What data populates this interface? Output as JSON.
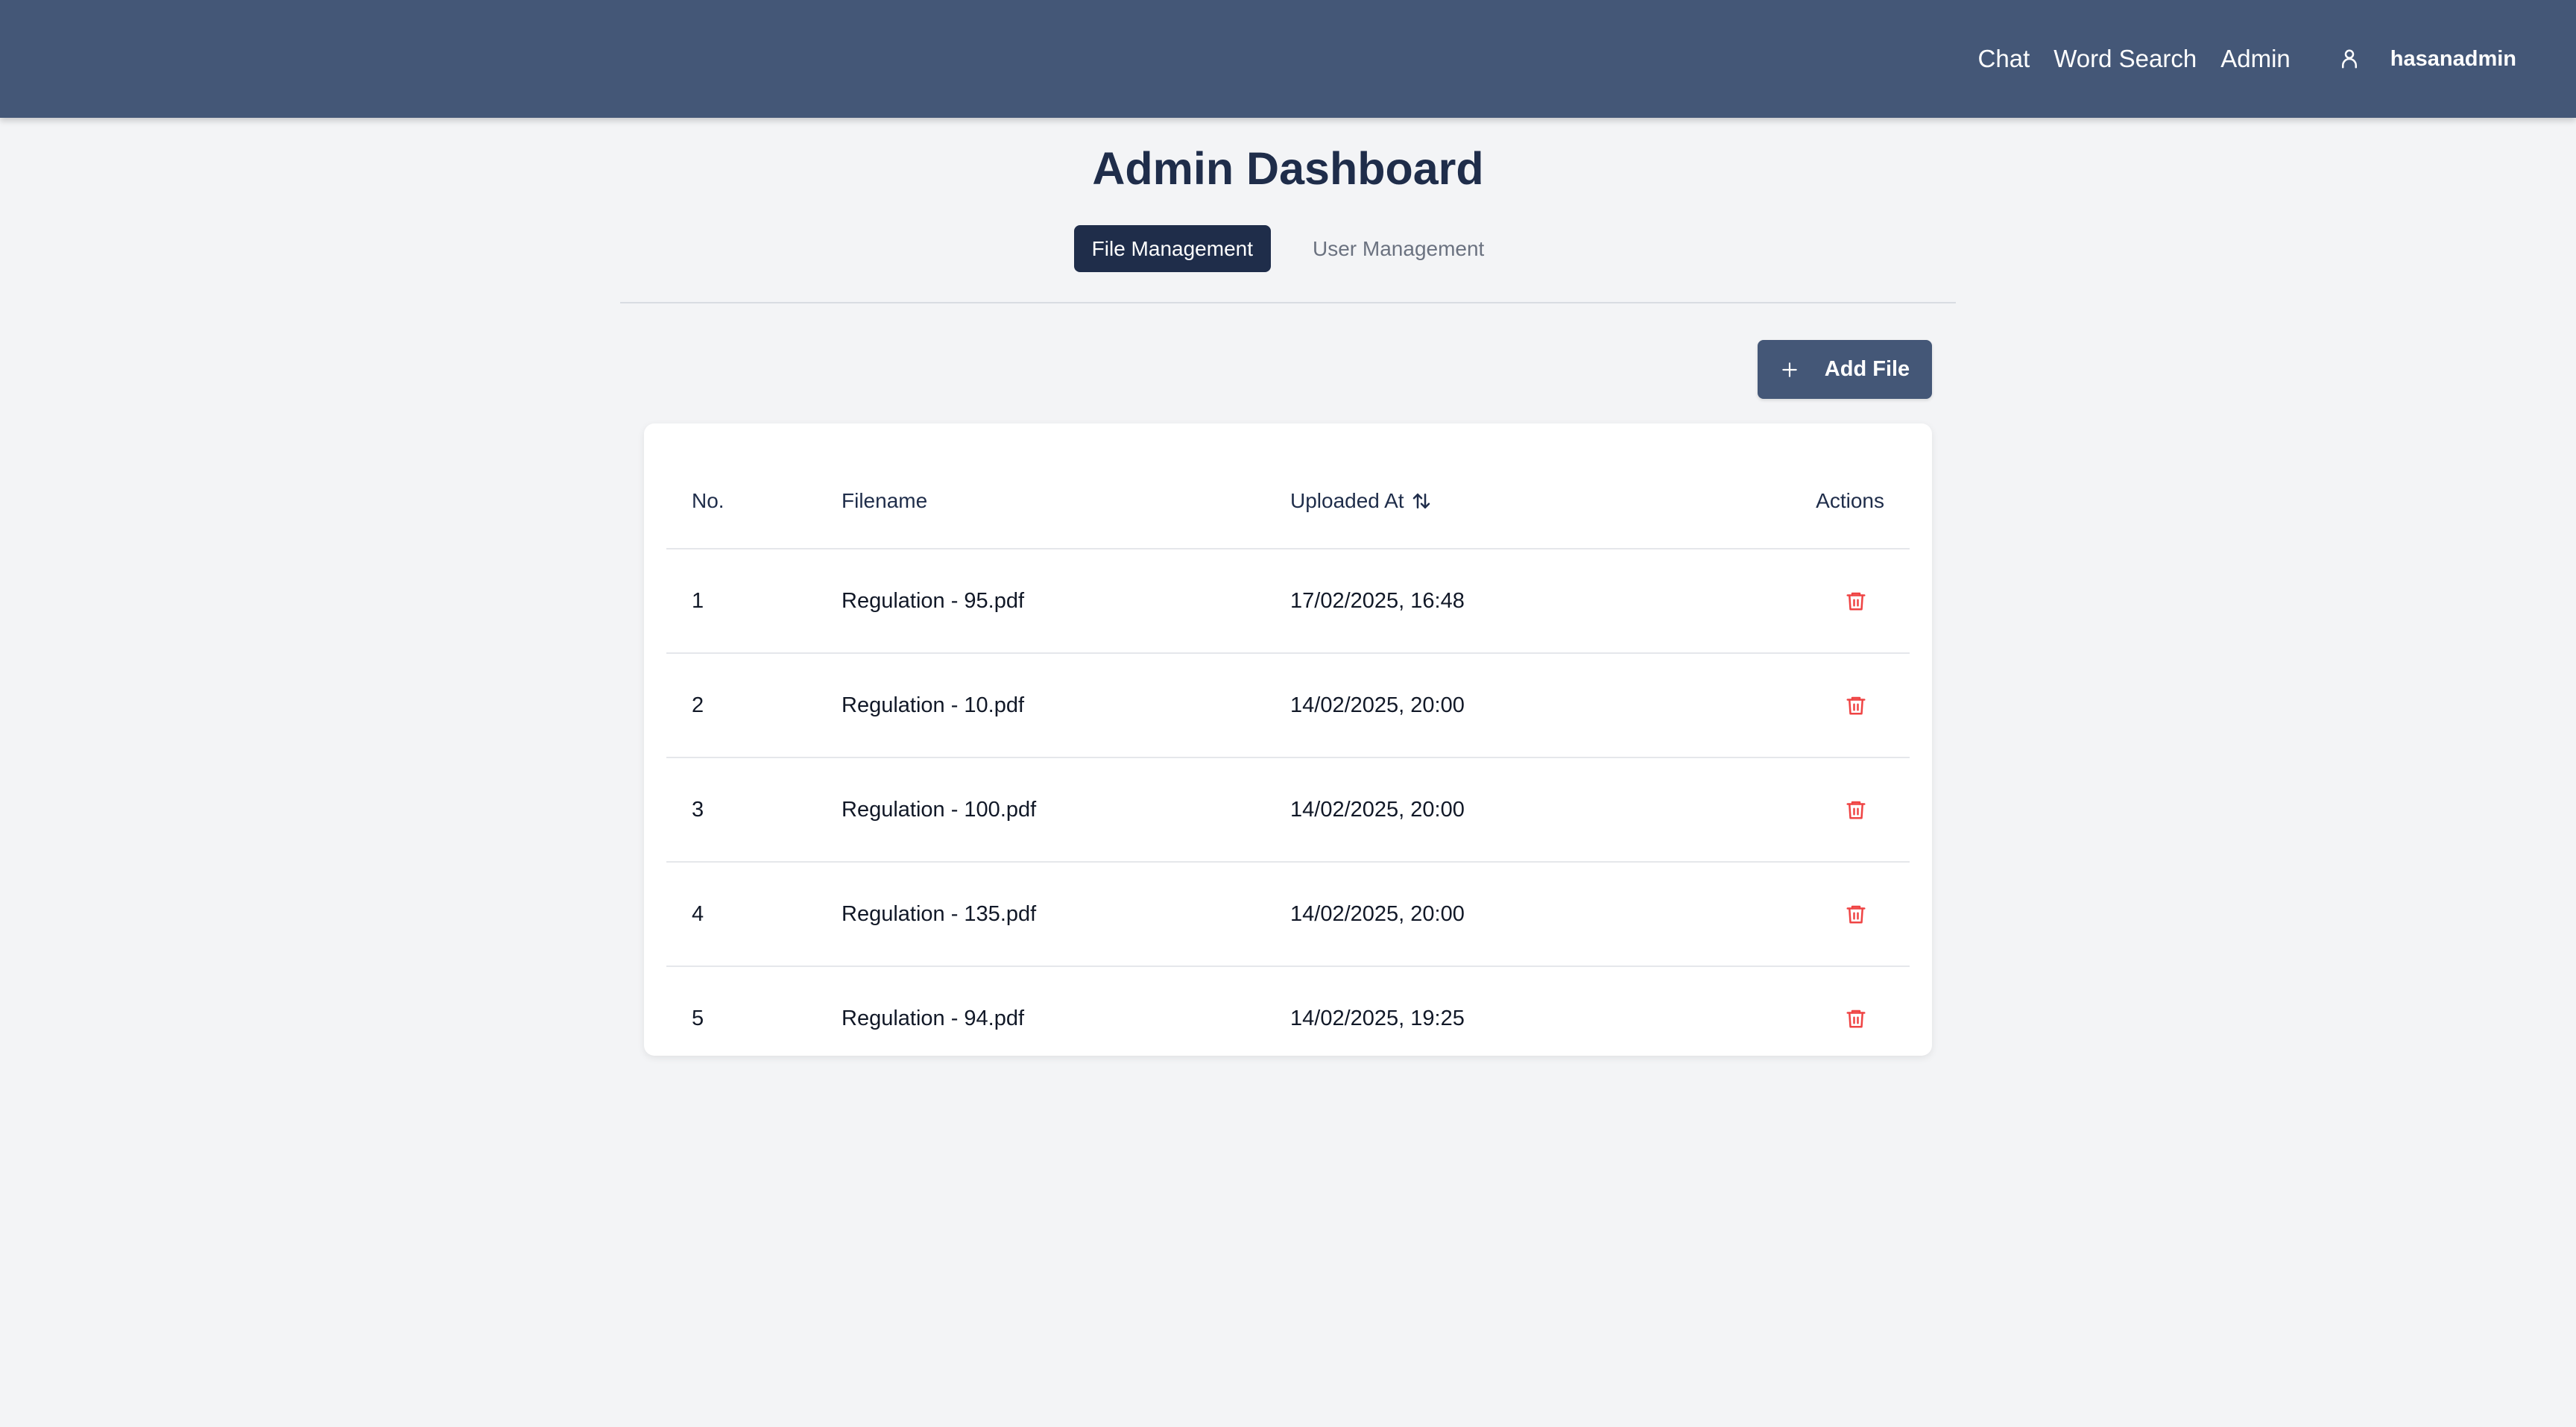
{
  "nav": {
    "links": [
      "Chat",
      "Word Search",
      "Admin"
    ],
    "username": "hasanadmin",
    "user_icon": "user-icon"
  },
  "page": {
    "title": "Admin Dashboard"
  },
  "tabs": [
    {
      "label": "File Management",
      "active": true
    },
    {
      "label": "User Management",
      "active": false
    }
  ],
  "toolbar": {
    "add_file_label": "Add File",
    "add_icon": "plus-icon"
  },
  "table": {
    "headers": {
      "no": "No.",
      "filename": "Filename",
      "uploaded_at": "Uploaded At",
      "actions": "Actions"
    },
    "sort_icon": "sort-arrows-icon",
    "delete_icon": "trash-icon",
    "rows": [
      {
        "no": "1",
        "filename": "Regulation - 95.pdf",
        "uploaded_at": "17/02/2025, 16:48"
      },
      {
        "no": "2",
        "filename": "Regulation - 10.pdf",
        "uploaded_at": "14/02/2025, 20:00"
      },
      {
        "no": "3",
        "filename": "Regulation - 100.pdf",
        "uploaded_at": "14/02/2025, 20:00"
      },
      {
        "no": "4",
        "filename": "Regulation - 135.pdf",
        "uploaded_at": "14/02/2025, 20:00"
      },
      {
        "no": "5",
        "filename": "Regulation - 94.pdf",
        "uploaded_at": "14/02/2025, 19:25"
      }
    ]
  },
  "colors": {
    "navbar": "#445777",
    "primary_dark": "#1f2d4a",
    "background": "#f3f4f6",
    "danger": "#ef4444"
  }
}
